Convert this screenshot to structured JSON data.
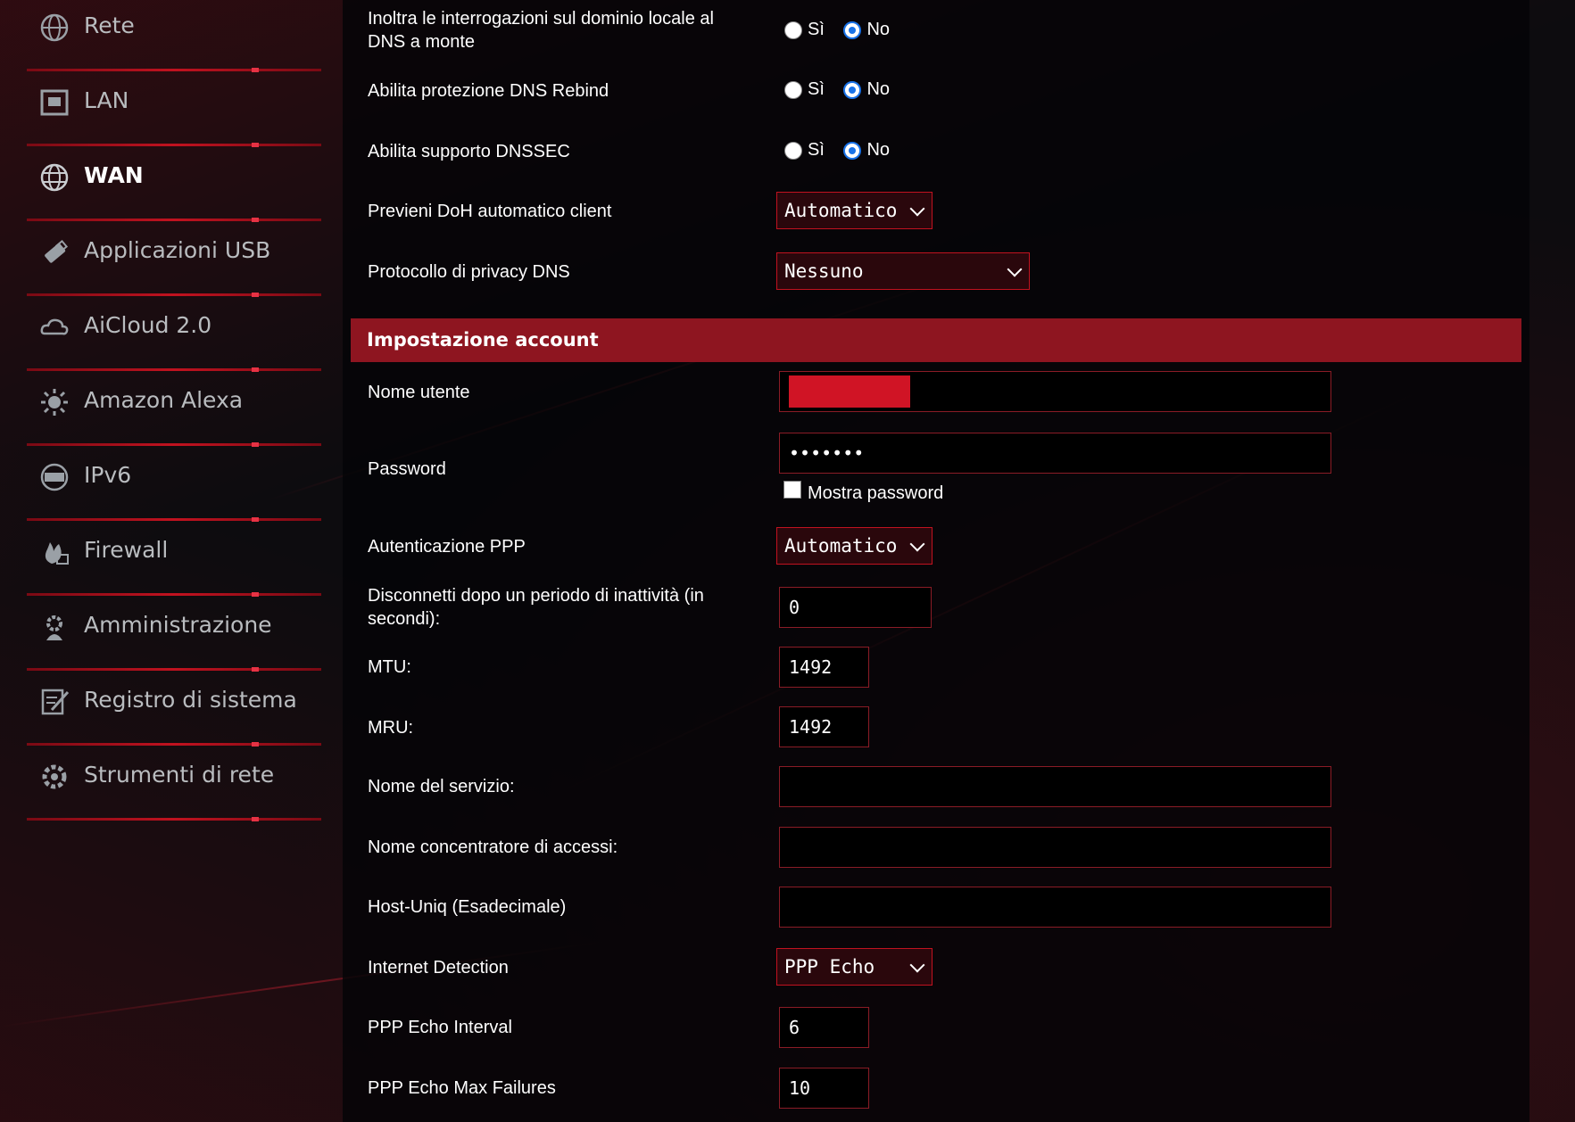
{
  "sidebar": {
    "items": [
      {
        "label": "Rete",
        "icon": "globe-icon"
      },
      {
        "label": "LAN",
        "icon": "lan-icon"
      },
      {
        "label": "WAN",
        "icon": "globe-icon",
        "active": true
      },
      {
        "label": "Applicazioni USB",
        "icon": "usb-icon"
      },
      {
        "label": "AiCloud 2.0",
        "icon": "cloud-icon"
      },
      {
        "label": "Amazon Alexa",
        "icon": "alexa-icon"
      },
      {
        "label": "IPv6",
        "icon": "ipv6-icon"
      },
      {
        "label": "Firewall",
        "icon": "fire-icon"
      },
      {
        "label": "Amministrazione",
        "icon": "admin-icon"
      },
      {
        "label": "Registro di sistema",
        "icon": "log-icon"
      },
      {
        "label": "Strumenti di rete",
        "icon": "tools-icon"
      }
    ]
  },
  "dns": {
    "forward_local": {
      "label": "Inoltra le interrogazioni sul dominio locale al DNS a monte",
      "yes": "Sì",
      "no": "No",
      "selected": "No"
    },
    "rebind": {
      "label": "Abilita protezione DNS Rebind",
      "yes": "Sì",
      "no": "No",
      "selected": "No"
    },
    "dnssec": {
      "label": "Abilita supporto DNSSEC",
      "yes": "Sì",
      "no": "No",
      "selected": "No"
    },
    "doh": {
      "label": "Previeni DoH automatico client",
      "value": "Automatico"
    },
    "privacy": {
      "label": "Protocollo di privacy DNS",
      "value": "Nessuno"
    }
  },
  "account": {
    "header": "Impostazione account",
    "username": {
      "label": "Nome utente"
    },
    "password": {
      "label": "Password",
      "value": "•••••••",
      "show_label": "Mostra password"
    },
    "ppp_auth": {
      "label": "Autenticazione PPP",
      "value": "Automatico"
    },
    "idle": {
      "label": "Disconnetti dopo un periodo di inattività (in secondi):",
      "value": "0"
    },
    "mtu": {
      "label": "MTU:",
      "value": "1492"
    },
    "mru": {
      "label": "MRU:",
      "value": "1492"
    },
    "service": {
      "label": "Nome del servizio:",
      "value": ""
    },
    "concentrator": {
      "label": "Nome concentratore di accessi:",
      "value": ""
    },
    "hostuniq": {
      "label": "Host-Uniq (Esadecimale)",
      "value": ""
    },
    "detection": {
      "label": "Internet Detection",
      "value": "PPP Echo"
    },
    "echo_interval": {
      "label": "PPP Echo Interval",
      "value": "6"
    },
    "echo_max": {
      "label": "PPP Echo Max Failures",
      "value": "10"
    }
  },
  "colors": {
    "accent": "#c1121f",
    "header": "#8e1520",
    "radio": "#1a73e8"
  }
}
